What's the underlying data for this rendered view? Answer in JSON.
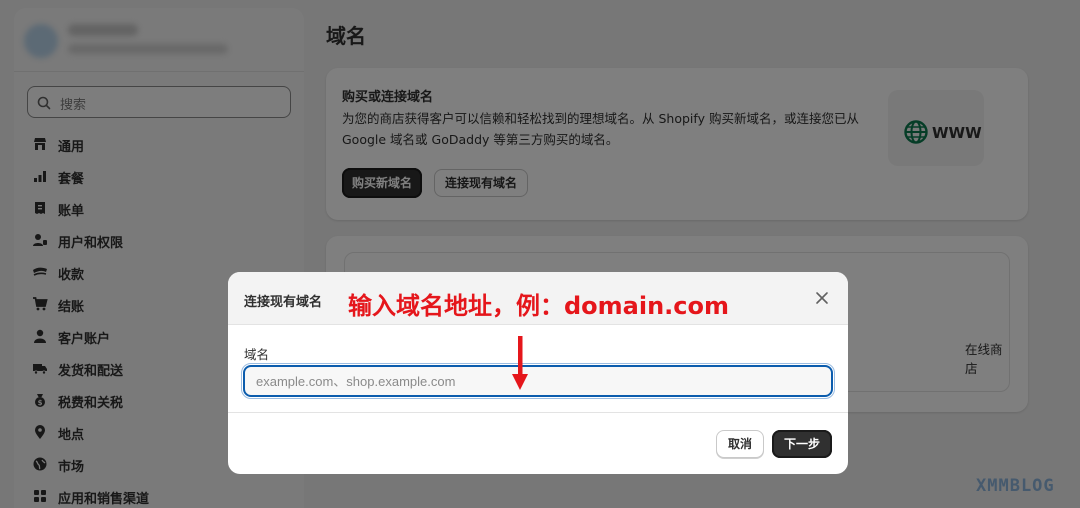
{
  "page": {
    "title": "域名"
  },
  "sidebar": {
    "search_placeholder": "搜索",
    "items": [
      {
        "label": "通用",
        "icon": "store-icon"
      },
      {
        "label": "套餐",
        "icon": "chart-bars-icon"
      },
      {
        "label": "账单",
        "icon": "receipt-icon"
      },
      {
        "label": "用户和权限",
        "icon": "users-icon"
      },
      {
        "label": "收款",
        "icon": "payment-icon"
      },
      {
        "label": "结账",
        "icon": "cart-icon"
      },
      {
        "label": "客户账户",
        "icon": "person-icon"
      },
      {
        "label": "发货和配送",
        "icon": "truck-icon"
      },
      {
        "label": "税费和关税",
        "icon": "tax-bag-icon"
      },
      {
        "label": "地点",
        "icon": "location-pin-icon"
      },
      {
        "label": "市场",
        "icon": "globe-icon"
      },
      {
        "label": "应用和销售渠道",
        "icon": "apps-icon"
      }
    ]
  },
  "buy_card": {
    "title": "购买或连接域名",
    "description": "为您的商店获得客户可以信赖和轻松找到的理想域名。从 Shopify 购买新域名，或连接您已从 Google 域名或 GoDaddy 等第三方购买的域名。",
    "buy_button": "购买新域名",
    "connect_button": "连接现有域名",
    "illustration_text": "WWW"
  },
  "domains_card": {
    "online_store_label": "在线商店"
  },
  "modal": {
    "title": "连接现有域名",
    "annotation": "输入域名地址，例：domain.com",
    "field_label": "域名",
    "field_placeholder": "example.com、shop.example.com",
    "cancel_button": "取消",
    "next_button": "下一步"
  },
  "watermark": "XMMBLOG",
  "colors": {
    "primary_button": "#303030",
    "focus_border": "#0b5cad",
    "annotation_red": "#e5161b",
    "globe_green": "#0d7a4f"
  }
}
